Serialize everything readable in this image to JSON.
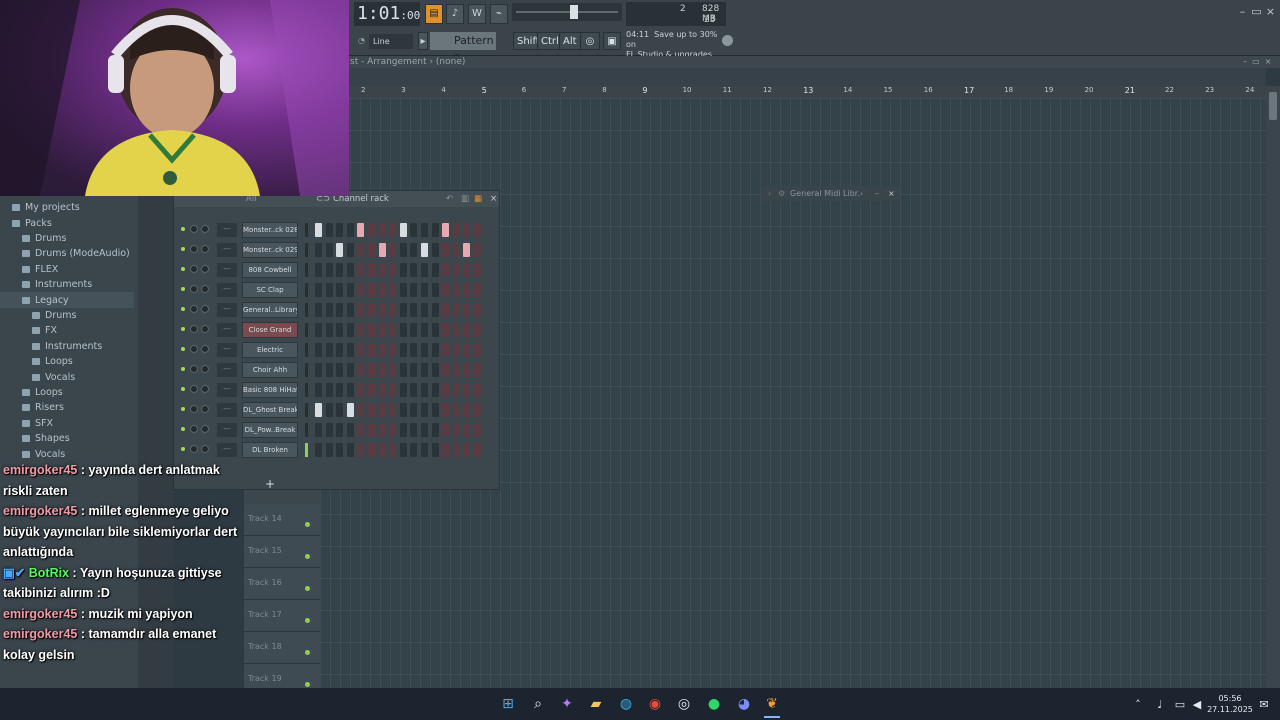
{
  "toolbar": {
    "time_main": "1:01",
    "time_sub": ":00",
    "cpu_value": "2",
    "memory": "828 MB",
    "voices": "23",
    "snap_mode": "Line",
    "pattern": "Pattern 1",
    "key_shift": "Shift",
    "key_ctrl": "Ctrl",
    "key_alt": "Alt",
    "news_time": "04:11",
    "news_line1": "Save up to 30% on",
    "news_line2": "FL Studio & upgrades"
  },
  "browser": {
    "items": [
      {
        "label": "My projects",
        "indent": 0
      },
      {
        "label": "Packs",
        "indent": 0
      },
      {
        "label": "Drums",
        "indent": 1
      },
      {
        "label": "Drums (ModeAudio)",
        "indent": 1
      },
      {
        "label": "FLEX",
        "indent": 1
      },
      {
        "label": "Instruments",
        "indent": 1
      },
      {
        "label": "Legacy",
        "indent": 1
      },
      {
        "label": "Drums",
        "indent": 2
      },
      {
        "label": "FX",
        "indent": 2
      },
      {
        "label": "Instruments",
        "indent": 2
      },
      {
        "label": "Loops",
        "indent": 2
      },
      {
        "label": "Vocals",
        "indent": 2
      },
      {
        "label": "Loops",
        "indent": 1
      },
      {
        "label": "Risers",
        "indent": 1
      },
      {
        "label": "SFX",
        "indent": 1
      },
      {
        "label": "Shapes",
        "indent": 1
      },
      {
        "label": "Vocals",
        "indent": 1
      }
    ]
  },
  "playlist": {
    "title": "st - Arrangement",
    "selection": "(none)",
    "ruler": [
      2,
      3,
      4,
      5,
      6,
      7,
      8,
      9,
      10,
      11,
      12,
      13,
      14,
      15,
      16,
      17,
      18,
      19,
      20,
      21,
      22,
      23,
      24
    ],
    "tracks": [
      "Track 14",
      "Track 15",
      "Track 16",
      "Track 17",
      "Track 18",
      "Track 19"
    ]
  },
  "channel_rack": {
    "title": "Channel rack",
    "filter": "All",
    "add_label": "+",
    "channels": [
      {
        "name": "Monster..ck 028",
        "steps": [
          1,
          0,
          0,
          0,
          1,
          0,
          0,
          0,
          1,
          0,
          0,
          0,
          1,
          0,
          0,
          0
        ]
      },
      {
        "name": "Monster..ck 029",
        "steps": [
          0,
          0,
          1,
          0,
          0,
          0,
          1,
          0,
          0,
          0,
          1,
          0,
          0,
          0,
          1,
          0
        ]
      },
      {
        "name": "808 Cowbell",
        "steps": [
          0,
          0,
          0,
          0,
          0,
          0,
          0,
          0,
          0,
          0,
          0,
          0,
          0,
          0,
          0,
          0
        ]
      },
      {
        "name": "SC Clap",
        "steps": [
          0,
          0,
          0,
          0,
          0,
          0,
          0,
          0,
          0,
          0,
          0,
          0,
          0,
          0,
          0,
          0
        ]
      },
      {
        "name": "General..Library",
        "steps": [
          0,
          0,
          0,
          0,
          0,
          0,
          0,
          0,
          0,
          0,
          0,
          0,
          0,
          0,
          0,
          0
        ]
      },
      {
        "name": "Close Grand",
        "steps": [
          0,
          0,
          0,
          0,
          0,
          0,
          0,
          0,
          0,
          0,
          0,
          0,
          0,
          0,
          0,
          0
        ],
        "highlight": true
      },
      {
        "name": "Electric",
        "steps": [
          0,
          0,
          0,
          0,
          0,
          0,
          0,
          0,
          0,
          0,
          0,
          0,
          0,
          0,
          0,
          0
        ]
      },
      {
        "name": "Choir Ahh",
        "steps": [
          0,
          0,
          0,
          0,
          0,
          0,
          0,
          0,
          0,
          0,
          0,
          0,
          0,
          0,
          0,
          0
        ]
      },
      {
        "name": "Basic 808 HiHat",
        "steps": [
          0,
          0,
          0,
          0,
          0,
          0,
          0,
          0,
          0,
          0,
          0,
          0,
          0,
          0,
          0,
          0
        ]
      },
      {
        "name": "DL_Ghost Break",
        "steps": [
          1,
          0,
          0,
          1,
          0,
          0,
          0,
          0,
          0,
          0,
          0,
          0,
          0,
          0,
          0,
          0
        ]
      },
      {
        "name": "DL_Pow..Break",
        "steps": [
          0,
          0,
          0,
          0,
          0,
          0,
          0,
          0,
          0,
          0,
          0,
          0,
          0,
          0,
          0,
          0
        ]
      },
      {
        "name": "DL Broken",
        "steps": [
          0,
          0,
          0,
          0,
          0,
          0,
          0,
          0,
          0,
          0,
          0,
          0,
          0,
          0,
          0,
          0
        ],
        "selected": true
      }
    ]
  },
  "midi_window": {
    "title": "General Midi Libr."
  },
  "chat": [
    {
      "user": "emirgoker45",
      "text": "yayında dert anlatmak riskli zaten"
    },
    {
      "user": "emirgoker45",
      "text": "millet eglenmeye geliyo büyük yayıncıları bile siklemiyorlar dert anlattığında"
    },
    {
      "user": "BotRix",
      "text": "Yayın hoşunuza gittiyse takibinizi alırım :D",
      "bot": true
    },
    {
      "user": "emirgoker45",
      "text": "muzik mi yapiyon"
    },
    {
      "user": "emirgoker45",
      "text": "tamamdır alla emanet kolay gelsin"
    }
  ],
  "taskbar": {
    "time": "05:56",
    "date": "27.11.2025"
  }
}
